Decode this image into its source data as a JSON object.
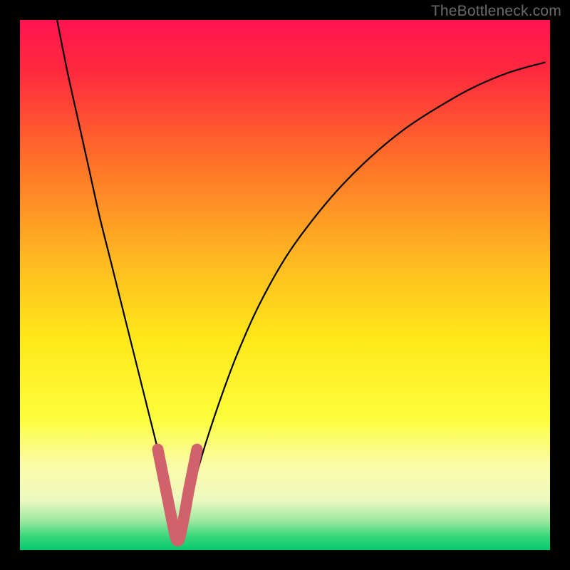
{
  "watermark": "TheBottleneck.com",
  "chart_data": {
    "type": "line",
    "title": "",
    "xlabel": "",
    "ylabel": "",
    "xlim": [
      0,
      100
    ],
    "ylim": [
      0,
      100
    ],
    "grid": false,
    "series": [
      {
        "name": "curve",
        "x": [
          7,
          9,
          11,
          13,
          15,
          17,
          19,
          21,
          23,
          24.5,
          26,
          27.5,
          28.8,
          29.5,
          30.5,
          31.5,
          33,
          35,
          38,
          41,
          45,
          50,
          55,
          60,
          66,
          72,
          78,
          85,
          92,
          99
        ],
        "y": [
          100,
          90,
          81,
          72,
          63,
          55,
          47,
          39,
          31,
          25,
          19,
          13,
          6,
          2,
          2,
          6,
          13,
          20,
          29,
          37,
          46,
          55,
          62,
          68,
          74,
          79,
          83,
          87,
          90,
          92
        ]
      }
    ],
    "highlight_segment": {
      "name": "bottom-hook",
      "color": "#d1626b",
      "x": [
        26.0,
        26.8,
        27.6,
        28.4,
        29.0,
        29.5,
        30.0,
        30.5,
        31.1,
        31.8,
        32.6,
        33.4
      ],
      "y": [
        19.0,
        15.0,
        11.0,
        7.0,
        4.0,
        2.0,
        2.0,
        4.0,
        7.0,
        11.0,
        15.0,
        19.0
      ]
    },
    "gradient": {
      "stops": [
        {
          "offset": 0.0,
          "color": "#ff1450"
        },
        {
          "offset": 0.1,
          "color": "#ff2a3e"
        },
        {
          "offset": 0.25,
          "color": "#ff6a2a"
        },
        {
          "offset": 0.45,
          "color": "#ffb820"
        },
        {
          "offset": 0.6,
          "color": "#ffe81a"
        },
        {
          "offset": 0.75,
          "color": "#fdfd3a"
        },
        {
          "offset": 0.84,
          "color": "#fbfca8"
        },
        {
          "offset": 0.905,
          "color": "#eef9c0"
        },
        {
          "offset": 0.945,
          "color": "#9ce8a0"
        },
        {
          "offset": 0.975,
          "color": "#35d77a"
        },
        {
          "offset": 1.0,
          "color": "#08c96e"
        }
      ]
    }
  }
}
